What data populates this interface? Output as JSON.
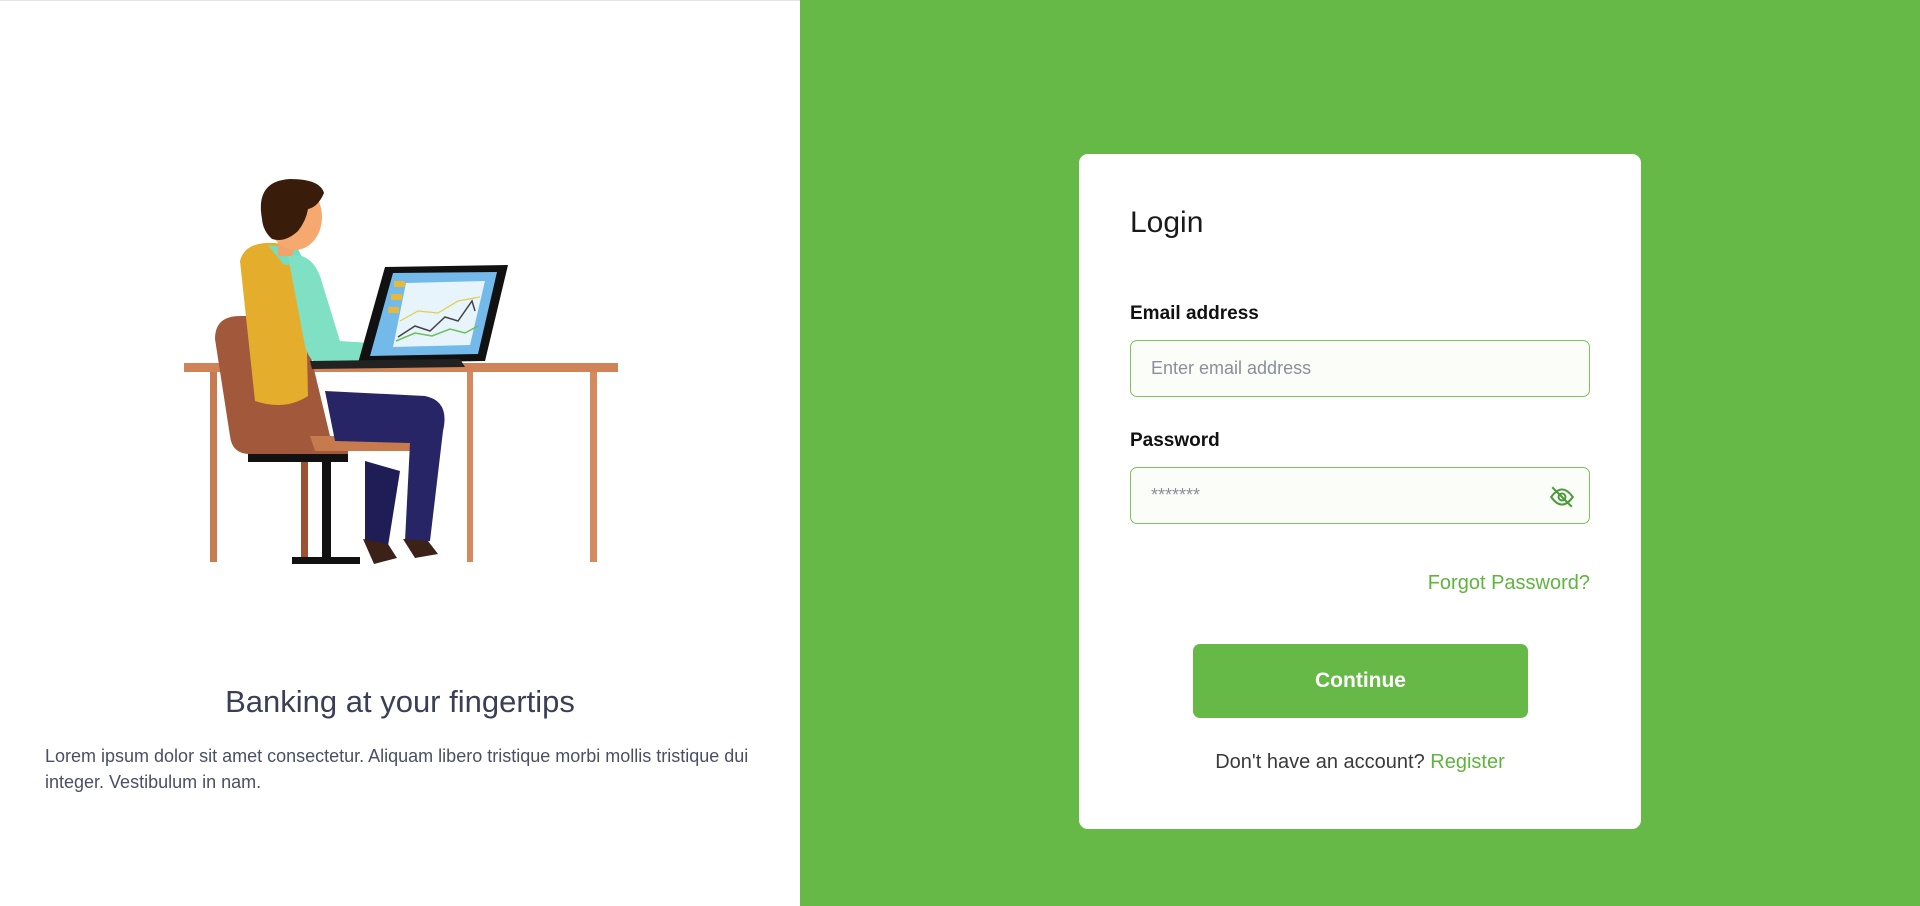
{
  "intro": {
    "tagline": "Banking at your fingertips",
    "description": "Lorem ipsum dolor sit amet consectetur. Aliquam libero tristique morbi mollis tristique dui integer. Vestibulum in nam.",
    "illustration_icon": "person-at-laptop-illustration"
  },
  "login": {
    "title": "Login",
    "email_label": "Email address",
    "email_placeholder": "Enter email address",
    "email_value": "",
    "password_label": "Password",
    "password_placeholder": "*******",
    "password_value": "",
    "password_toggle_icon": "eye-slash-icon",
    "forgot_password": "Forgot Password?",
    "continue_label": "Continue",
    "register_prompt": "Don't have an account?",
    "register_link": "Register"
  },
  "colors": {
    "brand_green": "#66b946",
    "link_green": "#5fb43e",
    "card_bg": "#ffffff",
    "input_border": "#7cc35f"
  }
}
